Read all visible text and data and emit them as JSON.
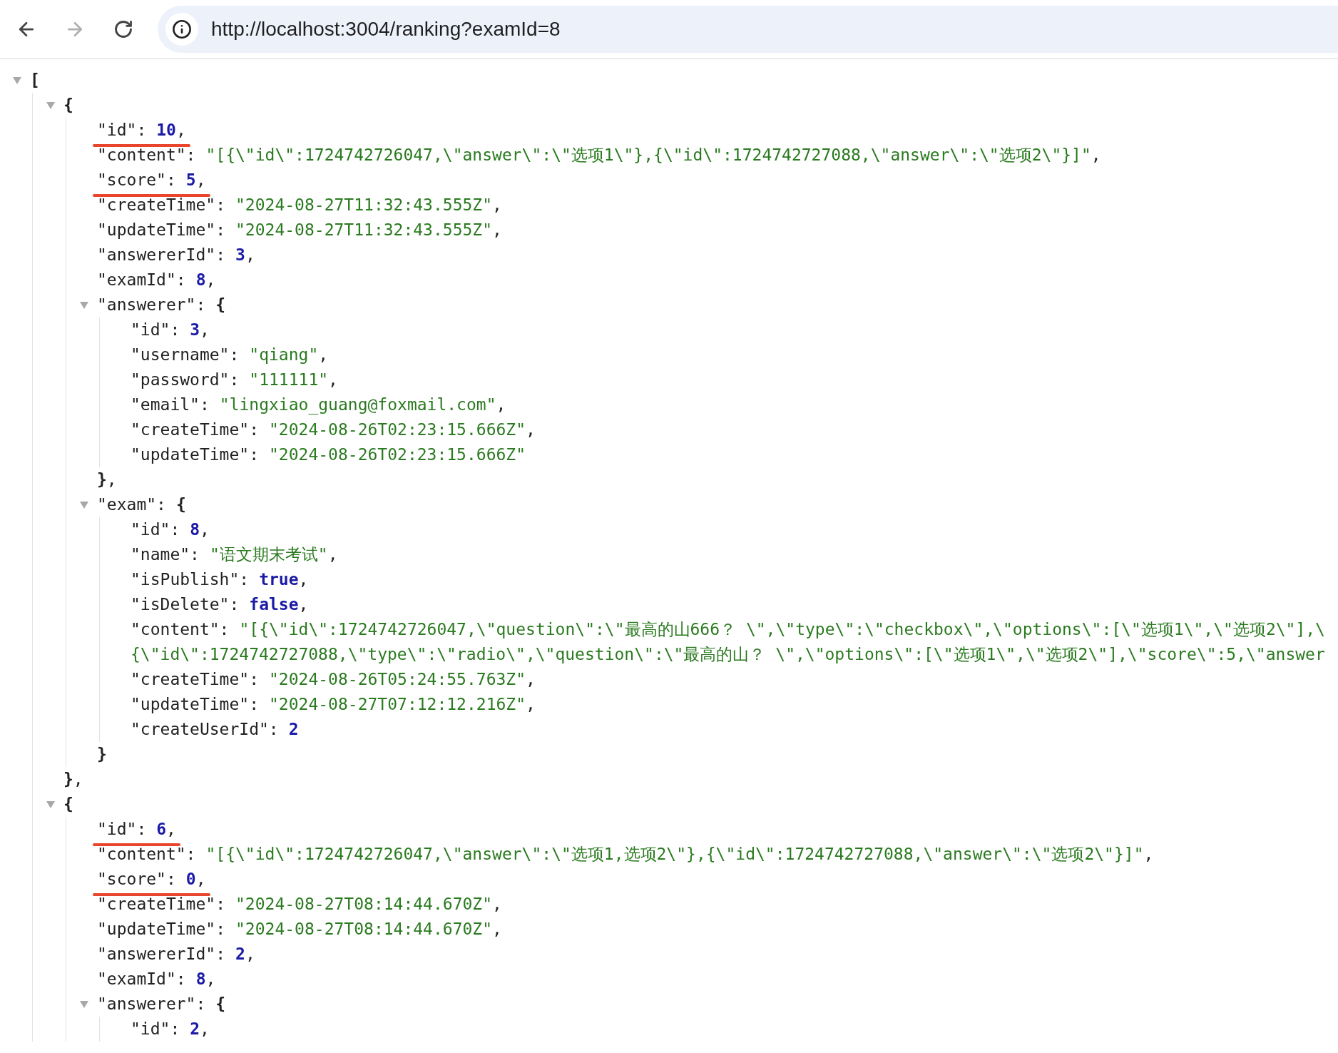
{
  "toolbar": {
    "back_enabled": true,
    "forward_enabled": false,
    "url": "http://localhost:3004/ranking?examId=8"
  },
  "document": {
    "kind": "array",
    "open": "[",
    "expanded": true,
    "children": [
      {
        "kind": "object",
        "open": "{",
        "expanded": true,
        "close": "}",
        "comma": ",",
        "children": [
          {
            "kind": "number",
            "key": "\"id\":",
            "value": "10",
            "comma": ",",
            "underlined": true
          },
          {
            "kind": "string",
            "key": "\"content\":",
            "value": "\"[{\\\"id\\\":1724742726047,\\\"answer\\\":\\\"选项1\\\"},{\\\"id\\\":1724742727088,\\\"answer\\\":\\\"选项2\\\"}]\"",
            "comma": ",",
            "underlined": false
          },
          {
            "kind": "number",
            "key": "\"score\":",
            "value": "5",
            "comma": ",",
            "underlined": true
          },
          {
            "kind": "string",
            "key": "\"createTime\":",
            "value": "\"2024-08-27T11:32:43.555Z\"",
            "comma": ",",
            "underlined": false
          },
          {
            "kind": "string",
            "key": "\"updateTime\":",
            "value": "\"2024-08-27T11:32:43.555Z\"",
            "comma": ",",
            "underlined": false
          },
          {
            "kind": "number",
            "key": "\"answererId\":",
            "value": "3",
            "comma": ",",
            "underlined": false
          },
          {
            "kind": "number",
            "key": "\"examId\":",
            "value": "8",
            "comma": ",",
            "underlined": false
          },
          {
            "kind": "object",
            "key": "\"answerer\":",
            "open": "{",
            "expanded": true,
            "close": "}",
            "comma": ",",
            "children": [
              {
                "kind": "number",
                "key": "\"id\":",
                "value": "3",
                "comma": ",",
                "underlined": false
              },
              {
                "kind": "string",
                "key": "\"username\":",
                "value": "\"qiang\"",
                "comma": ",",
                "underlined": false
              },
              {
                "kind": "string",
                "key": "\"password\":",
                "value": "\"111111\"",
                "comma": ",",
                "underlined": false
              },
              {
                "kind": "string",
                "key": "\"email\":",
                "value": "\"lingxiao_guang@foxmail.com\"",
                "comma": ",",
                "underlined": false
              },
              {
                "kind": "string",
                "key": "\"createTime\":",
                "value": "\"2024-08-26T02:23:15.666Z\"",
                "comma": ",",
                "underlined": false
              },
              {
                "kind": "string",
                "key": "\"updateTime\":",
                "value": "\"2024-08-26T02:23:15.666Z\"",
                "underlined": false
              }
            ]
          },
          {
            "kind": "object",
            "key": "\"exam\":",
            "open": "{",
            "expanded": true,
            "close": "}",
            "children": [
              {
                "kind": "number",
                "key": "\"id\":",
                "value": "8",
                "comma": ",",
                "underlined": false
              },
              {
                "kind": "string",
                "key": "\"name\":",
                "value": "\"语文期末考试\"",
                "comma": ",",
                "underlined": false
              },
              {
                "kind": "boolean",
                "key": "\"isPublish\":",
                "value": "true",
                "comma": ",",
                "underlined": false
              },
              {
                "kind": "boolean",
                "key": "\"isDelete\":",
                "value": "false",
                "comma": ",",
                "underlined": false
              },
              {
                "kind": "string",
                "key": "\"content\":",
                "value": "\"[{\\\"id\\\":1724742726047,\\\"question\\\":\\\"最高的山666？ \\\",\\\"type\\\":\\\"checkbox\\\",\\\"options\\\":[\\\"选项1\\\",\\\"选项2\\\"],\\",
                "continuation": "{\\\"id\\\":1724742727088,\\\"type\\\":\\\"radio\\\",\\\"question\\\":\\\"最高的山？ \\\",\\\"options\\\":[\\\"选项1\\\",\\\"选项2\\\"],\\\"score\\\":5,\\\"answer",
                "underlined": false
              },
              {
                "kind": "string",
                "key": "\"createTime\":",
                "value": "\"2024-08-26T05:24:55.763Z\"",
                "comma": ",",
                "underlined": false
              },
              {
                "kind": "string",
                "key": "\"updateTime\":",
                "value": "\"2024-08-27T07:12:12.216Z\"",
                "comma": ",",
                "underlined": false
              },
              {
                "kind": "number",
                "key": "\"createUserId\":",
                "value": "2",
                "underlined": false
              }
            ]
          }
        ]
      },
      {
        "kind": "object",
        "open": "{",
        "expanded": true,
        "children": [
          {
            "kind": "number",
            "key": "\"id\":",
            "value": "6",
            "comma": ",",
            "underlined": true
          },
          {
            "kind": "string",
            "key": "\"content\":",
            "value": "\"[{\\\"id\\\":1724742726047,\\\"answer\\\":\\\"选项1,选项2\\\"},{\\\"id\\\":1724742727088,\\\"answer\\\":\\\"选项2\\\"}]\"",
            "comma": ",",
            "underlined": false
          },
          {
            "kind": "number",
            "key": "\"score\":",
            "value": "0",
            "comma": ",",
            "underlined": true
          },
          {
            "kind": "string",
            "key": "\"createTime\":",
            "value": "\"2024-08-27T08:14:44.670Z\"",
            "comma": ",",
            "underlined": false
          },
          {
            "kind": "string",
            "key": "\"updateTime\":",
            "value": "\"2024-08-27T08:14:44.670Z\"",
            "comma": ",",
            "underlined": false
          },
          {
            "kind": "number",
            "key": "\"answererId\":",
            "value": "2",
            "comma": ",",
            "underlined": false
          },
          {
            "kind": "number",
            "key": "\"examId\":",
            "value": "8",
            "comma": ",",
            "underlined": false
          },
          {
            "kind": "object",
            "key": "\"answerer\":",
            "open": "{",
            "expanded": true,
            "children": [
              {
                "kind": "number",
                "key": "\"id\":",
                "value": "2",
                "comma": ",",
                "underlined": false
              }
            ]
          }
        ]
      }
    ]
  }
}
